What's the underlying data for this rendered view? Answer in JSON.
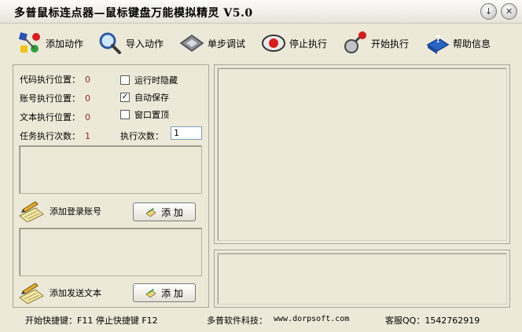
{
  "window": {
    "title": "多普鼠标连点器—鼠标键盘万能模拟精灵 V5.0"
  },
  "titlebar_buttons": {
    "minimize_icon": "↓",
    "close_icon": "✕"
  },
  "toolbar": {
    "items": [
      {
        "label": "添加动作",
        "icon": "add-action-icon"
      },
      {
        "label": "导入动作",
        "icon": "magnifier-icon"
      },
      {
        "label": "单步调试",
        "icon": "debug-icon"
      },
      {
        "label": "停止执行",
        "icon": "stop-icon"
      },
      {
        "label": "开始执行",
        "icon": "start-icon"
      },
      {
        "label": "帮助信息",
        "icon": "help-book-icon"
      }
    ]
  },
  "left": {
    "code_pos_label": "代码执行位置：",
    "code_pos_value": "0",
    "account_pos_label": "账号执行位置：",
    "account_pos_value": "0",
    "text_pos_label": "文本执行位置：",
    "text_pos_value": "0",
    "task_count_label": "任务执行次数：",
    "task_count_value": "1",
    "hide_on_run": {
      "label": "运行时隐藏",
      "checked": false
    },
    "auto_save": {
      "label": "自动保存",
      "checked": true,
      "mark": "✓"
    },
    "window_top": {
      "label": "窗口置顶",
      "checked": false
    },
    "exec_count_label": "执行次数：",
    "exec_count_value": "1",
    "add_account_label": "添加登录账号",
    "add_text_label": "添加发送文本",
    "add_button_label": "添 加"
  },
  "status": {
    "hotkeys": "开始快捷键：F11   停止快捷键 F12",
    "company": "多普软件科技：",
    "website": "www.dorpsoft.com",
    "support": "客服QQ：1542762919"
  }
}
